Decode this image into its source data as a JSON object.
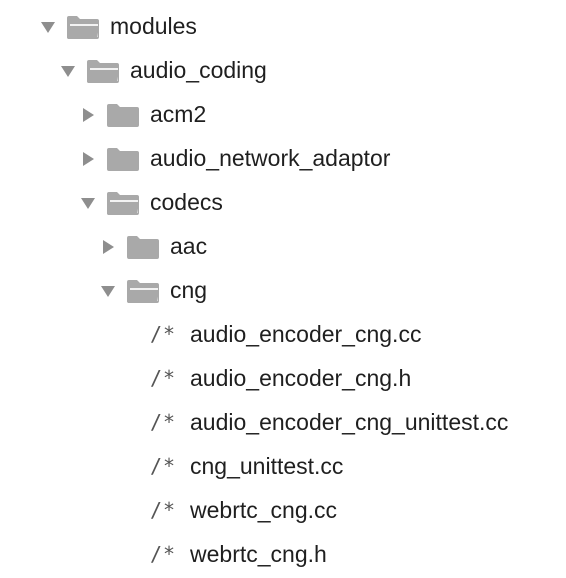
{
  "tree": {
    "modules": {
      "label": "modules",
      "expanded": true,
      "icon": "folder-open-icon"
    },
    "audio_coding": {
      "label": "audio_coding",
      "expanded": true,
      "icon": "folder-open-icon"
    },
    "acm2": {
      "label": "acm2",
      "expanded": false,
      "icon": "folder-closed-icon"
    },
    "audio_network_adaptor": {
      "label": "audio_network_adaptor",
      "expanded": false,
      "icon": "folder-closed-icon"
    },
    "codecs": {
      "label": "codecs",
      "expanded": true,
      "icon": "folder-open-icon"
    },
    "aac": {
      "label": "aac",
      "expanded": false,
      "icon": "folder-closed-icon"
    },
    "cng": {
      "label": "cng",
      "expanded": true,
      "icon": "folder-open-icon"
    },
    "files": [
      {
        "label": "audio_encoder_cng.cc",
        "icon_glyph": "/*"
      },
      {
        "label": "audio_encoder_cng.h",
        "icon_glyph": "/*"
      },
      {
        "label": "audio_encoder_cng_unittest.cc",
        "icon_glyph": "/*"
      },
      {
        "label": "cng_unittest.cc",
        "icon_glyph": "/*"
      },
      {
        "label": "webrtc_cng.cc",
        "icon_glyph": "/*"
      },
      {
        "label": "webrtc_cng.h",
        "icon_glyph": "/*"
      }
    ]
  },
  "colors": {
    "folder": "#a9a9a9",
    "disclosure": "#8e8e8e",
    "text": "#1f1f1f"
  }
}
